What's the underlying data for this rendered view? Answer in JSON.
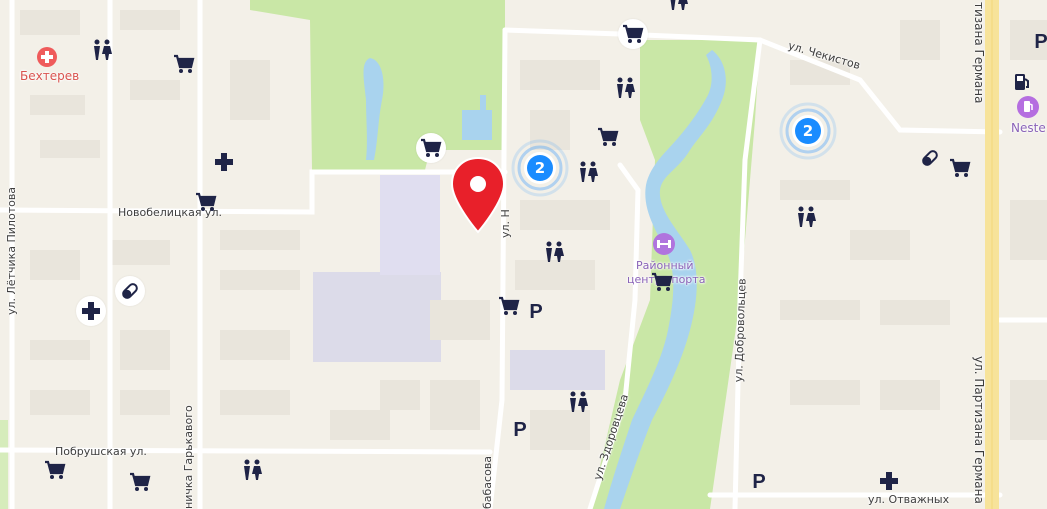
{
  "map": {
    "colors": {
      "background": "#f3f0e8",
      "park": "#c9e7a6",
      "water": "#a9d3ee",
      "road": "#ffffff",
      "major_road": "#f7e39a",
      "building": "#e8e4da",
      "industrial": "#dcdbe9",
      "poi_icon": "#1f2447",
      "pharmacy_icon": "#1f2447",
      "hospital_red": "#ef5b5b",
      "cluster_blue": "#1a8cff",
      "pin_red": "#e8202a",
      "fuel_purple": "#b56ee0"
    },
    "street_labels": {
      "chekistov": "ул. Чекистов",
      "novobelitskaya": "Новобелицкая ул.",
      "letchika_pilotova": "ул. Лётчика Пилотова",
      "dobrovoltsev": "ул. Добровольцев",
      "zdorovtseva": "ул. Здоровцева",
      "partizana_germana_right": "ул. Партизана Германа",
      "partizana_germana_top": "тизана Германа",
      "pobrushskaya": "Побрушская ул.",
      "garkavogo": "ничка Гарькавого",
      "otvazhnykh": "ул. Отважных",
      "vertical_center": "ул. Н",
      "abbasova": "бабасова",
      "zdorovtseva_short": "ул. Здоровцева"
    },
    "poi_labels": {
      "bekhterev": "Бехтерев",
      "neste": "Neste",
      "sport_center_line1": "Районный",
      "sport_center_line2": "центр спорта"
    },
    "clusters": {
      "left_count": "2",
      "right_count": "2"
    },
    "parking_letter": "P"
  }
}
